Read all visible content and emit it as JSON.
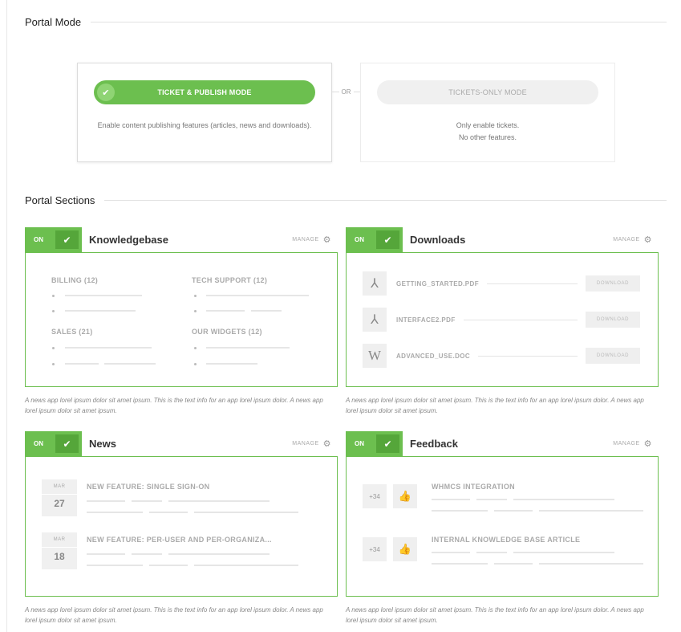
{
  "portal_mode": {
    "heading": "Portal Mode",
    "or_label": "OR",
    "options": [
      {
        "label": "TICKET & PUBLISH MODE",
        "description": "Enable content publishing features (articles, news and downloads).",
        "selected": true
      },
      {
        "label": "TICKETS-ONLY MODE",
        "description_line1": "Only enable tickets.",
        "description_line2": "No other features.",
        "selected": false
      }
    ]
  },
  "portal_sections": {
    "heading": "Portal Sections",
    "toggle_on_label": "ON",
    "manage_label": "MANAGE",
    "note": "A news app lorel ipsum dolor sit amet ipsum. This is the text info for an app lorel ipsum dolor. A news app lorel ipsum dolor sit amet ipsum.",
    "knowledgebase": {
      "title": "Knowledgebase",
      "categories": [
        "BILLING (12)",
        "TECH SUPPORT (12)",
        "SALES (21)",
        "OUR WIDGETS (12)"
      ]
    },
    "downloads": {
      "title": "Downloads",
      "button_label": "DOWNLOAD",
      "files": [
        {
          "name": "GETTING_STARTED.PDF",
          "icon": "pdf-icon",
          "glyph": "⅄"
        },
        {
          "name": "INTERFACE2.PDF",
          "icon": "pdf-icon",
          "glyph": "⅄"
        },
        {
          "name": "ADVANCED_USE.DOC",
          "icon": "word-doc-icon",
          "glyph": "W"
        }
      ]
    },
    "news": {
      "title": "News",
      "items": [
        {
          "month": "MAR",
          "day": "27",
          "title": "NEW FEATURE: SINGLE SIGN-ON"
        },
        {
          "month": "MAR",
          "day": "18",
          "title": "NEW FEATURE: PER-USER AND PER-ORGANIZA..."
        }
      ]
    },
    "feedback": {
      "title": "Feedback",
      "items": [
        {
          "votes": "+34",
          "title": "WHMCS INTEGRATION"
        },
        {
          "votes": "+34",
          "title": "INTERNAL KNOWLEDGE BASE ARTICLE"
        }
      ]
    }
  },
  "colors": {
    "accent": "#6cbf4f",
    "accent_dark": "#55a63a",
    "muted": "#f0f0f0"
  }
}
